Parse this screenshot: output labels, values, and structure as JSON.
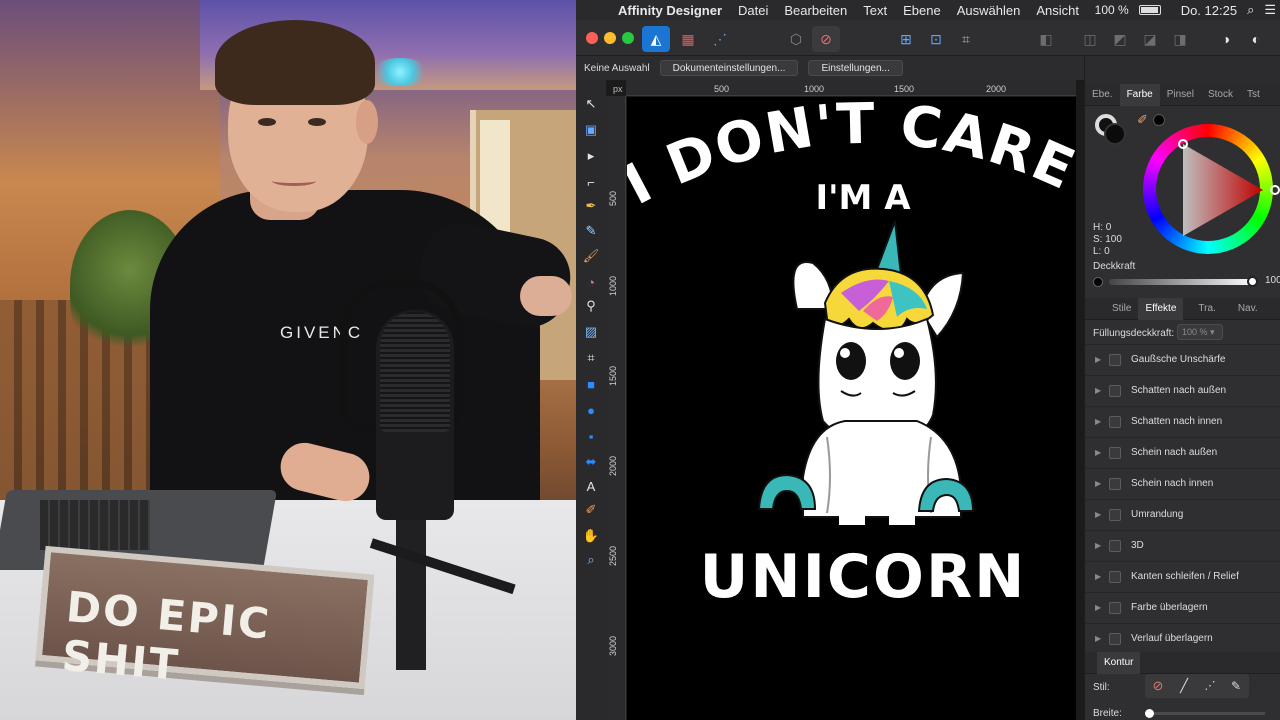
{
  "menubar": {
    "apple": "",
    "app_name": "Affinity Designer",
    "items": [
      "Datei",
      "Bearbeiten",
      "Text",
      "Ebene",
      "Auswählen",
      "Ansicht"
    ],
    "battery": "100 %",
    "clock": "Do. 12:25"
  },
  "context": {
    "selection": "Keine Auswahl",
    "doc_settings": "Dokumenteinstellungen...",
    "settings": "Einstellungen..."
  },
  "ruler": {
    "unit": "px",
    "top": [
      "500",
      "1000",
      "1500",
      "2000"
    ],
    "left": [
      "500",
      "1000",
      "1500",
      "2000",
      "2500",
      "3000"
    ]
  },
  "artwork": {
    "line1": "I DON'T CARE",
    "line2": "I'M A",
    "line3": "UNICORN"
  },
  "color_panel": {
    "tabs": [
      "Ebe.",
      "Farbe",
      "Pinsel",
      "Stock",
      "Tst"
    ],
    "active_tab": "Farbe",
    "h": "H: 0",
    "s": "S: 100",
    "l": "L: 0",
    "opacity_label": "Deckkraft",
    "opacity_value": "100",
    "accent": "#ff0000"
  },
  "effects_panel": {
    "tabs": [
      "Stile",
      "Effekte",
      "Tra.",
      "Nav."
    ],
    "active_tab": "Effekte",
    "fill_opacity_label": "Füllungsdeckkraft:",
    "fill_opacity_value": "100 %",
    "effects": [
      "Gaußsche Unschärfe",
      "Schatten nach außen",
      "Schatten nach innen",
      "Schein nach außen",
      "Schein nach innen",
      "Umrandung",
      "3D",
      "Kanten schleifen / Relief",
      "Farbe überlagern",
      "Verlauf überlagern"
    ]
  },
  "stroke_panel": {
    "title": "Kontur",
    "style_label": "Stil:",
    "width_label": "Breite:"
  },
  "photo": {
    "sign_text": "DO EPIC SHIT",
    "shirt_text": "GIVENC"
  }
}
